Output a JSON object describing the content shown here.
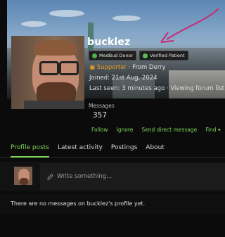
{
  "profile": {
    "username": "bucklez",
    "badges": [
      {
        "label": "MedBud Donor",
        "icon": "medbud-leaf-icon",
        "color": "#4caf50"
      },
      {
        "label": "Verified Patient",
        "icon": "verified-shield-icon",
        "color": "#56c15a"
      }
    ],
    "supporter_label": "Supporter",
    "location": "From Derry",
    "joined": "Joined: 21st Aug, 2024",
    "last_seen": "Last seen: 3 minutes ago",
    "activity": "Viewing forum list",
    "messages_label": "Messages",
    "messages_count": "357"
  },
  "actions": {
    "follow": "Follow",
    "ignore": "Ignore",
    "dm": "Send direct message",
    "find": "Find"
  },
  "tabs": [
    {
      "label": "Profile posts",
      "active": true
    },
    {
      "label": "Latest activity"
    },
    {
      "label": "Postings"
    },
    {
      "label": "About"
    }
  ],
  "composer": {
    "placeholder": "Write something..."
  },
  "empty_message": "There are no messages on bucklez's profile yet.",
  "colors": {
    "accent": "#7fd65a",
    "supporter": "#f0a020",
    "annotation": "#c2337a"
  }
}
